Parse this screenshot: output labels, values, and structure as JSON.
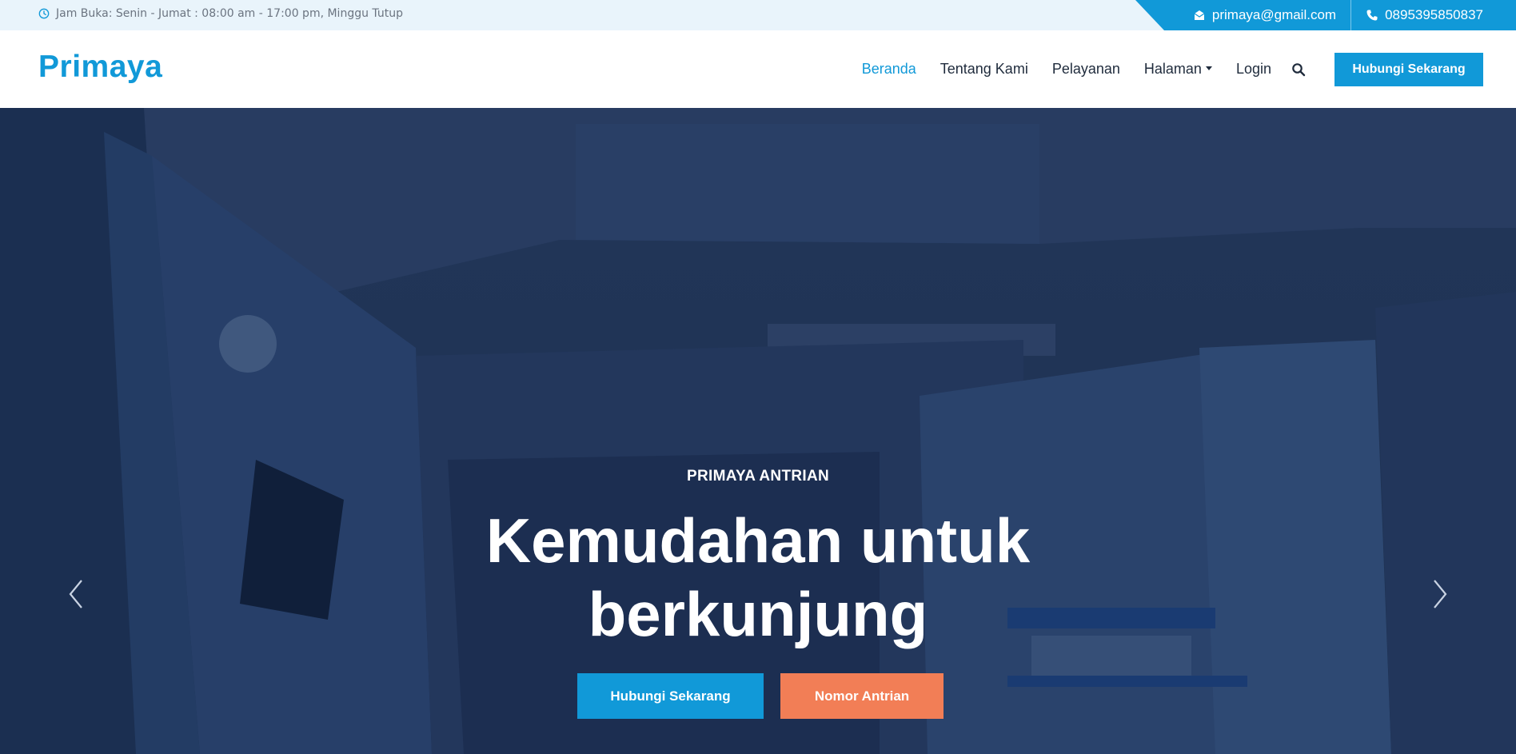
{
  "topbar": {
    "hours_icon": "clock-icon",
    "hours_text": "Jam Buka: Senin - Jumat : 08:00 am - 17:00 pm, Minggu Tutup",
    "email_icon": "envelope-icon",
    "email": "primaya@gmail.com",
    "phone_icon": "phone-icon",
    "phone": "0895395850837"
  },
  "navbar": {
    "logo": "Primaya",
    "links": [
      {
        "label": "Beranda",
        "active": true
      },
      {
        "label": "Tentang Kami",
        "active": false
      },
      {
        "label": "Pelayanan",
        "active": false
      },
      {
        "label": "Halaman",
        "active": false,
        "dropdown": true
      },
      {
        "label": "Login",
        "active": false
      }
    ],
    "search_icon": "search-icon",
    "cta_label": "Hubungi Sekarang"
  },
  "hero": {
    "eyebrow": "PRIMAYA ANTRIAN",
    "title_line1": "Kemudahan untuk",
    "title_line2": "berkunjung",
    "primary_button": "Hubungi Sekarang",
    "secondary_button": "Nomor Antrian",
    "prev_icon": "chevron-left-icon",
    "next_icon": "chevron-right-icon"
  },
  "colors": {
    "brand": "#1199d8",
    "accent": "#f27e56",
    "hero_overlay": "#223556",
    "text_dark": "#1f2b3c"
  }
}
